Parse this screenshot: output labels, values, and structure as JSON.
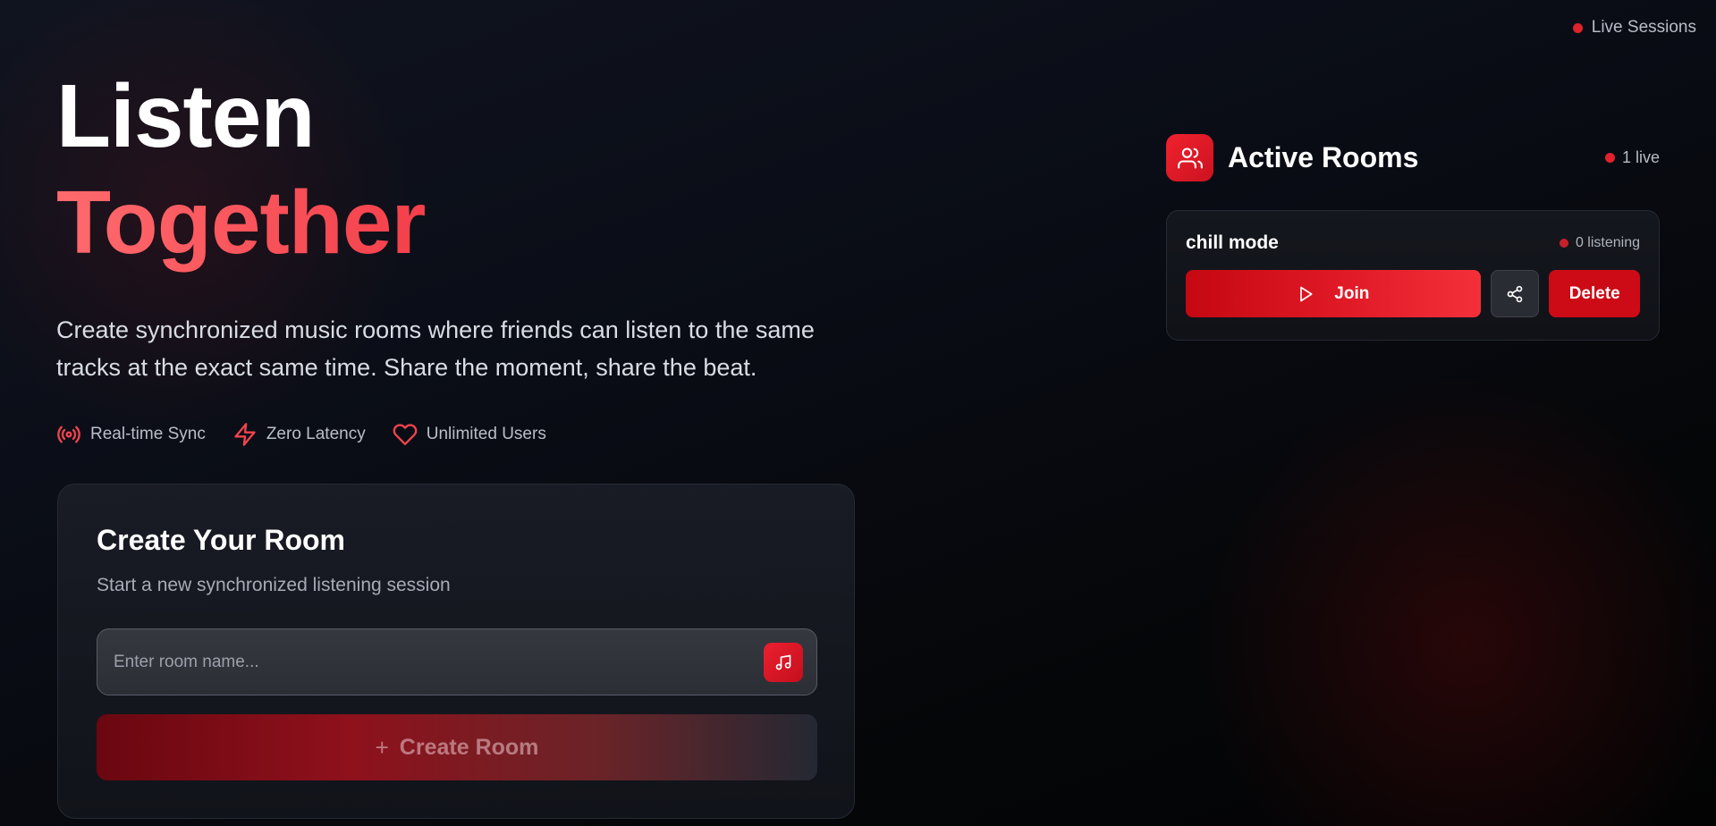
{
  "header": {
    "live_sessions_label": "Live Sessions"
  },
  "hero": {
    "title_line1": "Listen",
    "title_line2": "Together",
    "description": "Create synchronized music rooms where friends can listen to the same tracks at the exact same time. Share the moment, share the beat.",
    "features": [
      {
        "icon": "broadcast-icon",
        "label": "Real-time Sync"
      },
      {
        "icon": "lightning-icon",
        "label": "Zero Latency"
      },
      {
        "icon": "heart-icon",
        "label": "Unlimited Users"
      }
    ]
  },
  "create_room": {
    "title": "Create Your Room",
    "subtitle": "Start a new synchronized listening session",
    "input_value": "",
    "input_placeholder": "Enter room name...",
    "input_icon": "music-note-icon",
    "button_label": "Create Room",
    "button_icon": "plus-icon"
  },
  "active_rooms": {
    "title": "Active Rooms",
    "header_icon": "users-icon",
    "live_count_label": "1 live",
    "rooms": [
      {
        "name": "chill mode",
        "listening_label": "0 listening",
        "join_label": "Join",
        "join_icon": "play-icon",
        "share_icon": "share-icon",
        "delete_label": "Delete"
      }
    ]
  },
  "colors": {
    "accent": "#e0222c",
    "accent_gradient_start": "#ff6b6e",
    "background": "#07090f",
    "card_border": "#262a34",
    "muted_text": "#b7bcc6"
  }
}
